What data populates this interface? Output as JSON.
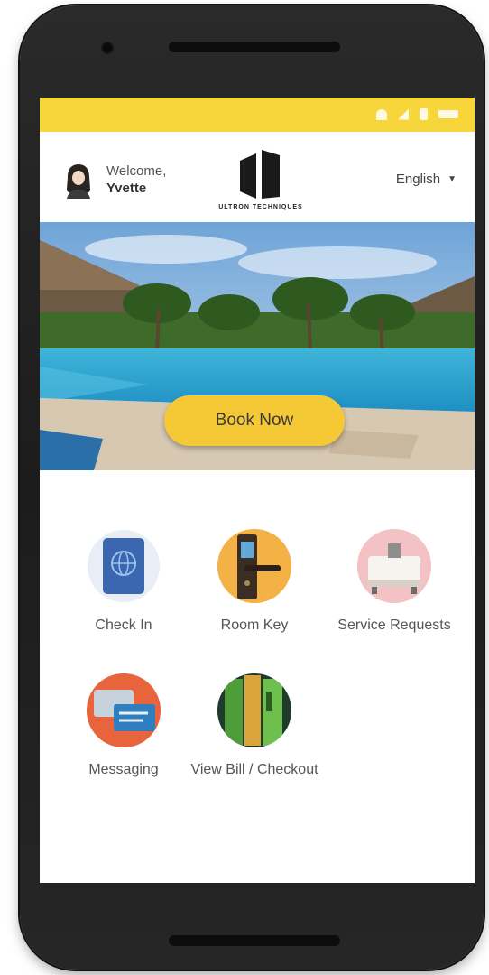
{
  "header": {
    "welcome": "Welcome,",
    "user_name": "Yvette",
    "logo_text": "ULTRON TECHNIQUES",
    "language": "English"
  },
  "hero": {
    "book_button": "Book Now"
  },
  "menu": [
    {
      "label": "Check In",
      "icon": "passport-icon"
    },
    {
      "label": "Room Key",
      "icon": "door-lock-icon"
    },
    {
      "label": "Service Requests",
      "icon": "service-bell-icon"
    },
    {
      "label": "Messaging",
      "icon": "chat-bubbles-icon"
    },
    {
      "label": "View Bill / Checkout",
      "icon": "credit-card-icon"
    }
  ],
  "colors": {
    "accent_yellow": "#f7d63c",
    "button_yellow": "#f5c836",
    "phone_body": "#1e1e1e"
  }
}
